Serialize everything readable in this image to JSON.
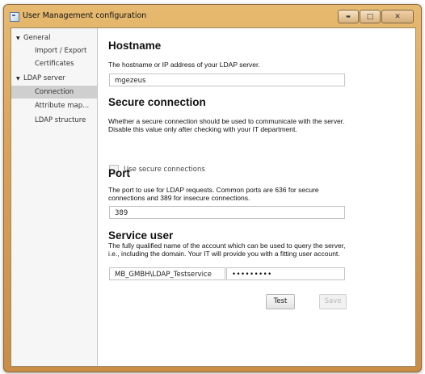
{
  "window": {
    "title": "User Management configuration",
    "controls": {
      "minimize_glyph": "▬",
      "maximize_glyph": "□",
      "close_glyph": "✕"
    }
  },
  "sidebar": {
    "groups": [
      {
        "label": "General",
        "expanded": true,
        "items": [
          {
            "label": "Import / Export",
            "selected": false
          },
          {
            "label": "Certificates",
            "selected": false
          }
        ]
      },
      {
        "label": "LDAP server",
        "expanded": true,
        "items": [
          {
            "label": "Connection",
            "selected": true
          },
          {
            "label": "Attribute map...",
            "selected": false
          },
          {
            "label": "LDAP structure",
            "selected": false
          }
        ]
      }
    ],
    "expanded_glyph": "▼"
  },
  "hostname": {
    "heading": "Hostname",
    "description": "The hostname or IP address of your LDAP server.",
    "value": "mgezeus"
  },
  "secure": {
    "heading": "Secure connection",
    "description": "Whether a secure connection should be used to communicate with the server. Disable this value only after checking with your IT department.",
    "checkbox_label": "Use secure connections",
    "checked": false
  },
  "port": {
    "heading": "Port",
    "description": "The port to use for LDAP requests. Common ports are 636 for secure connections and 389 for insecure connections.",
    "value": "389"
  },
  "service_user": {
    "heading": "Service user",
    "description": "The fully qualified name of the account which can be used to query the server, i.e., including the domain. Your IT will provide you with a fitting user account.",
    "username": "MB_GMBH\\LDAP_Testservice",
    "password_masked": "•••••••••"
  },
  "actions": {
    "test_label": "Test",
    "save_label": "Save",
    "save_enabled": false
  }
}
